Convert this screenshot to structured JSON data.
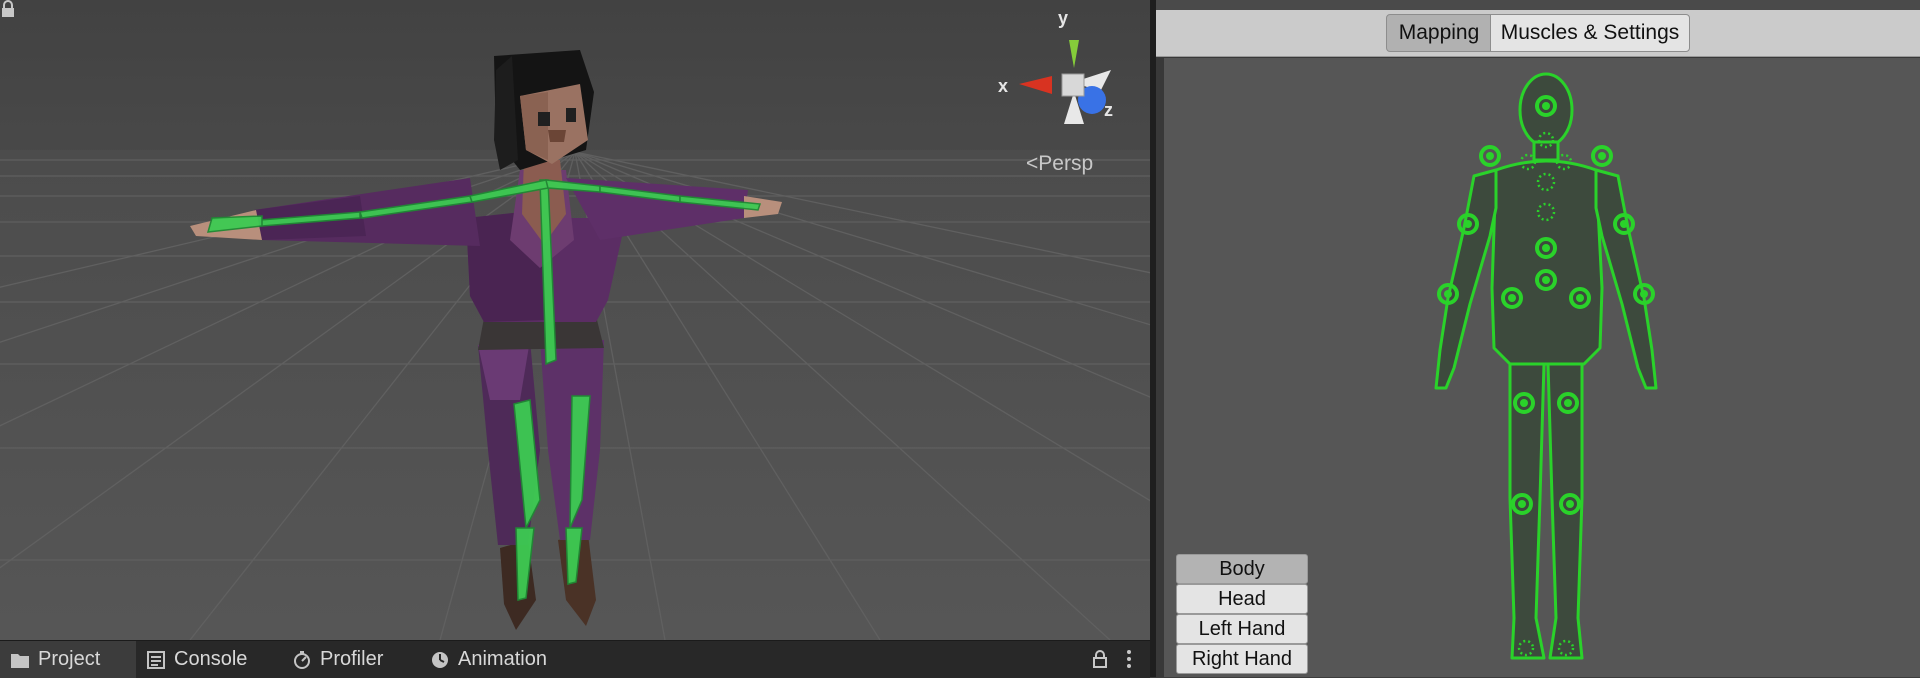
{
  "scene": {
    "projection_label": "<Persp",
    "gizmo": {
      "x_label": "x",
      "y_label": "y",
      "z_label": "z"
    }
  },
  "bottom_tabs": [
    {
      "label": "Project",
      "icon": "folder-icon",
      "active": true
    },
    {
      "label": "Console",
      "icon": "console-icon",
      "active": false
    },
    {
      "label": "Profiler",
      "icon": "profiler-icon",
      "active": false
    },
    {
      "label": "Animation",
      "icon": "animation-icon",
      "active": false
    }
  ],
  "avatar": {
    "tabs": {
      "mapping": "Mapping",
      "muscles": "Muscles & Settings"
    },
    "active_tab": "Mapping",
    "body_parts": [
      "Body",
      "Head",
      "Left Hand",
      "Right Hand"
    ],
    "active_part": "Body",
    "colors": {
      "bone": "#2fd14b",
      "body_fill": "#3d4a3d",
      "outline": "#2ad22a"
    }
  }
}
